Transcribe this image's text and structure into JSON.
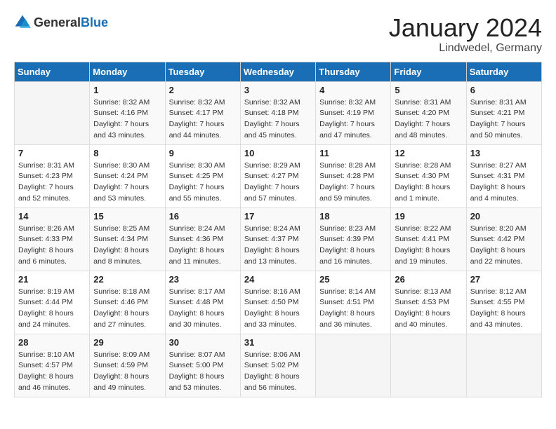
{
  "logo": {
    "general": "General",
    "blue": "Blue"
  },
  "title": "January 2024",
  "location": "Lindwedel, Germany",
  "days_of_week": [
    "Sunday",
    "Monday",
    "Tuesday",
    "Wednesday",
    "Thursday",
    "Friday",
    "Saturday"
  ],
  "weeks": [
    [
      {
        "num": "",
        "detail": ""
      },
      {
        "num": "1",
        "detail": "Sunrise: 8:32 AM\nSunset: 4:16 PM\nDaylight: 7 hours\nand 43 minutes."
      },
      {
        "num": "2",
        "detail": "Sunrise: 8:32 AM\nSunset: 4:17 PM\nDaylight: 7 hours\nand 44 minutes."
      },
      {
        "num": "3",
        "detail": "Sunrise: 8:32 AM\nSunset: 4:18 PM\nDaylight: 7 hours\nand 45 minutes."
      },
      {
        "num": "4",
        "detail": "Sunrise: 8:32 AM\nSunset: 4:19 PM\nDaylight: 7 hours\nand 47 minutes."
      },
      {
        "num": "5",
        "detail": "Sunrise: 8:31 AM\nSunset: 4:20 PM\nDaylight: 7 hours\nand 48 minutes."
      },
      {
        "num": "6",
        "detail": "Sunrise: 8:31 AM\nSunset: 4:21 PM\nDaylight: 7 hours\nand 50 minutes."
      }
    ],
    [
      {
        "num": "7",
        "detail": "Sunrise: 8:31 AM\nSunset: 4:23 PM\nDaylight: 7 hours\nand 52 minutes."
      },
      {
        "num": "8",
        "detail": "Sunrise: 8:30 AM\nSunset: 4:24 PM\nDaylight: 7 hours\nand 53 minutes."
      },
      {
        "num": "9",
        "detail": "Sunrise: 8:30 AM\nSunset: 4:25 PM\nDaylight: 7 hours\nand 55 minutes."
      },
      {
        "num": "10",
        "detail": "Sunrise: 8:29 AM\nSunset: 4:27 PM\nDaylight: 7 hours\nand 57 minutes."
      },
      {
        "num": "11",
        "detail": "Sunrise: 8:28 AM\nSunset: 4:28 PM\nDaylight: 7 hours\nand 59 minutes."
      },
      {
        "num": "12",
        "detail": "Sunrise: 8:28 AM\nSunset: 4:30 PM\nDaylight: 8 hours\nand 1 minute."
      },
      {
        "num": "13",
        "detail": "Sunrise: 8:27 AM\nSunset: 4:31 PM\nDaylight: 8 hours\nand 4 minutes."
      }
    ],
    [
      {
        "num": "14",
        "detail": "Sunrise: 8:26 AM\nSunset: 4:33 PM\nDaylight: 8 hours\nand 6 minutes."
      },
      {
        "num": "15",
        "detail": "Sunrise: 8:25 AM\nSunset: 4:34 PM\nDaylight: 8 hours\nand 8 minutes."
      },
      {
        "num": "16",
        "detail": "Sunrise: 8:24 AM\nSunset: 4:36 PM\nDaylight: 8 hours\nand 11 minutes."
      },
      {
        "num": "17",
        "detail": "Sunrise: 8:24 AM\nSunset: 4:37 PM\nDaylight: 8 hours\nand 13 minutes."
      },
      {
        "num": "18",
        "detail": "Sunrise: 8:23 AM\nSunset: 4:39 PM\nDaylight: 8 hours\nand 16 minutes."
      },
      {
        "num": "19",
        "detail": "Sunrise: 8:22 AM\nSunset: 4:41 PM\nDaylight: 8 hours\nand 19 minutes."
      },
      {
        "num": "20",
        "detail": "Sunrise: 8:20 AM\nSunset: 4:42 PM\nDaylight: 8 hours\nand 22 minutes."
      }
    ],
    [
      {
        "num": "21",
        "detail": "Sunrise: 8:19 AM\nSunset: 4:44 PM\nDaylight: 8 hours\nand 24 minutes."
      },
      {
        "num": "22",
        "detail": "Sunrise: 8:18 AM\nSunset: 4:46 PM\nDaylight: 8 hours\nand 27 minutes."
      },
      {
        "num": "23",
        "detail": "Sunrise: 8:17 AM\nSunset: 4:48 PM\nDaylight: 8 hours\nand 30 minutes."
      },
      {
        "num": "24",
        "detail": "Sunrise: 8:16 AM\nSunset: 4:50 PM\nDaylight: 8 hours\nand 33 minutes."
      },
      {
        "num": "25",
        "detail": "Sunrise: 8:14 AM\nSunset: 4:51 PM\nDaylight: 8 hours\nand 36 minutes."
      },
      {
        "num": "26",
        "detail": "Sunrise: 8:13 AM\nSunset: 4:53 PM\nDaylight: 8 hours\nand 40 minutes."
      },
      {
        "num": "27",
        "detail": "Sunrise: 8:12 AM\nSunset: 4:55 PM\nDaylight: 8 hours\nand 43 minutes."
      }
    ],
    [
      {
        "num": "28",
        "detail": "Sunrise: 8:10 AM\nSunset: 4:57 PM\nDaylight: 8 hours\nand 46 minutes."
      },
      {
        "num": "29",
        "detail": "Sunrise: 8:09 AM\nSunset: 4:59 PM\nDaylight: 8 hours\nand 49 minutes."
      },
      {
        "num": "30",
        "detail": "Sunrise: 8:07 AM\nSunset: 5:00 PM\nDaylight: 8 hours\nand 53 minutes."
      },
      {
        "num": "31",
        "detail": "Sunrise: 8:06 AM\nSunset: 5:02 PM\nDaylight: 8 hours\nand 56 minutes."
      },
      {
        "num": "",
        "detail": ""
      },
      {
        "num": "",
        "detail": ""
      },
      {
        "num": "",
        "detail": ""
      }
    ]
  ]
}
